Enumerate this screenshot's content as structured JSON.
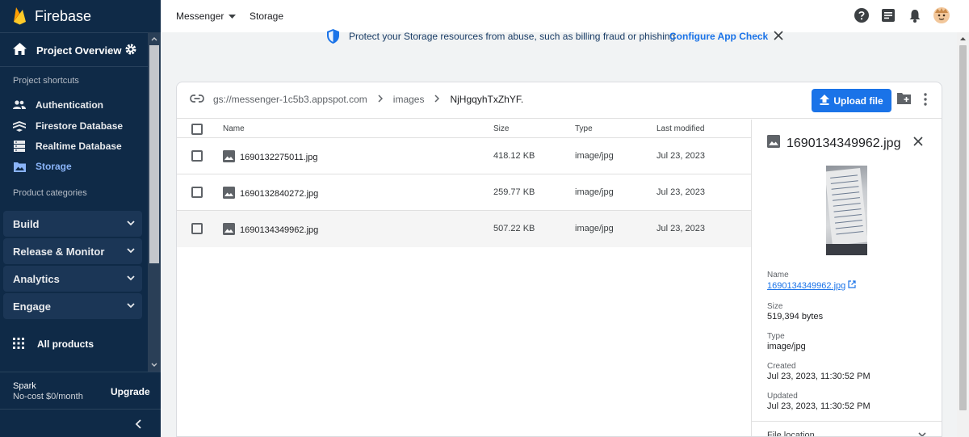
{
  "sidebar": {
    "brand": "Firebase",
    "project_overview": "Project Overview",
    "shortcuts_title": "Project shortcuts",
    "shortcuts": [
      {
        "label": "Authentication",
        "icon": "people-icon"
      },
      {
        "label": "Firestore Database",
        "icon": "firestore-icon"
      },
      {
        "label": "Realtime Database",
        "icon": "database-icon"
      },
      {
        "label": "Storage",
        "icon": "image-folder-icon",
        "active": true
      }
    ],
    "categories_title": "Product categories",
    "categories": [
      "Build",
      "Release & Monitor",
      "Analytics",
      "Engage"
    ],
    "all_products": "All products",
    "plan_name": "Spark",
    "plan_detail": "No-cost $0/month",
    "upgrade": "Upgrade"
  },
  "topbar": {
    "project": "Messenger",
    "section": "Storage"
  },
  "banner": {
    "message": "Protect your Storage resources from abuse, such as billing fraud or phishing",
    "cta": "Configure App Check"
  },
  "browser": {
    "bucket": "gs://messenger-1c5b3.appspot.com",
    "folder": "images",
    "subfolder": "NjHgqyhTxZhYF.",
    "upload_label": "Upload file",
    "columns": {
      "name": "Name",
      "size": "Size",
      "type": "Type",
      "modified": "Last modified"
    },
    "files": [
      {
        "name": "1690132275011.jpg",
        "size": "418.12 KB",
        "type": "image/jpg",
        "modified": "Jul 23, 2023"
      },
      {
        "name": "1690132840272.jpg",
        "size": "259.77 KB",
        "type": "image/jpg",
        "modified": "Jul 23, 2023"
      },
      {
        "name": "1690134349962.jpg",
        "size": "507.22 KB",
        "type": "image/jpg",
        "modified": "Jul 23, 2023"
      }
    ]
  },
  "detail": {
    "title": "1690134349962.jpg",
    "name_label": "Name",
    "name_value": "1690134349962.jpg",
    "size_label": "Size",
    "size_value": "519,394 bytes",
    "type_label": "Type",
    "type_value": "image/jpg",
    "created_label": "Created",
    "created_value": "Jul 23, 2023, 11:30:52 PM",
    "updated_label": "Updated",
    "updated_value": "Jul 23, 2023, 11:30:52 PM",
    "file_location": "File location"
  },
  "colors": {
    "sidebar_bg": "#0f2a47",
    "accent": "#1a73e8",
    "active_item": "#8ab4f8"
  }
}
